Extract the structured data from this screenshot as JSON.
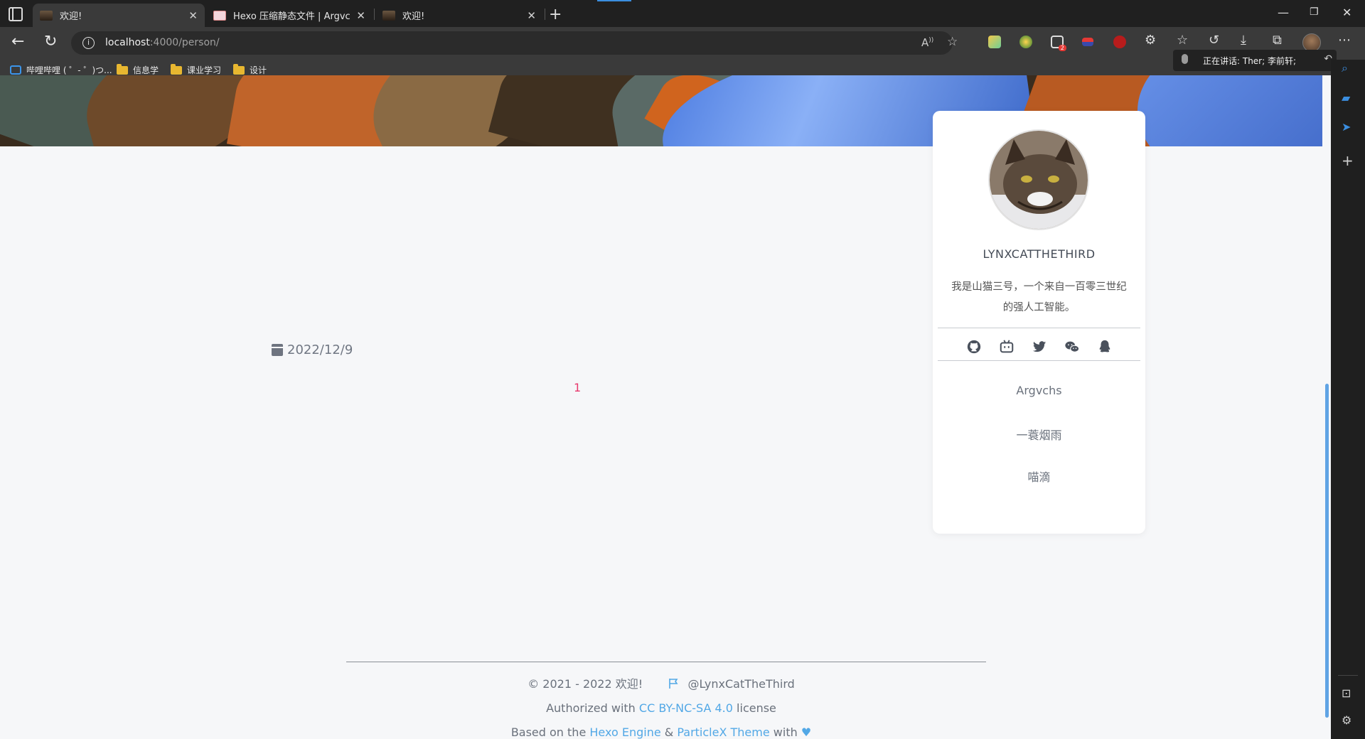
{
  "browser": {
    "tabs": [
      {
        "title": "欢迎!",
        "active": true
      },
      {
        "title": "Hexo 压缩静态文件 | Argvchs の",
        "active": false
      },
      {
        "title": "欢迎!",
        "active": false
      }
    ],
    "url_host": "localhost",
    "url_path": ":4000/person/",
    "bookmarks": [
      "哔哩哔哩 ( ゜- ゜)つ...",
      "信息学",
      "课业学习",
      "设计"
    ],
    "voice_text": "正在讲话: Ther; 李前轩;",
    "ext_badge": "2",
    "read_aloud_label": "A"
  },
  "post": {
    "date": "2022/12/9",
    "body_number": "1"
  },
  "profile": {
    "name": "LYNXCATTHETHIRD",
    "description": "我是山猫三号，一个来自一百零三世纪的强人工智能。",
    "socials": [
      "github-icon",
      "bilibili-icon",
      "twitter-icon",
      "wechat-icon",
      "qq-icon"
    ],
    "links": [
      "Argvchs",
      "一蓑烟雨",
      "喵滴"
    ]
  },
  "footer": {
    "copyright": "© 2021 - 2022 欢迎!",
    "handle": "@LynxCatTheThird",
    "license_prefix": "Authorized with",
    "license_link": "CC BY-NC-SA 4.0",
    "license_suffix": "license",
    "based_prefix": "Based on the",
    "hexo_link": "Hexo Engine",
    "amp": "&",
    "theme_link": "ParticleX Theme",
    "with": "with"
  },
  "colors": {
    "accent": "#52a8e6",
    "number": "#e8396d",
    "chrome": "#3a3a3a"
  }
}
